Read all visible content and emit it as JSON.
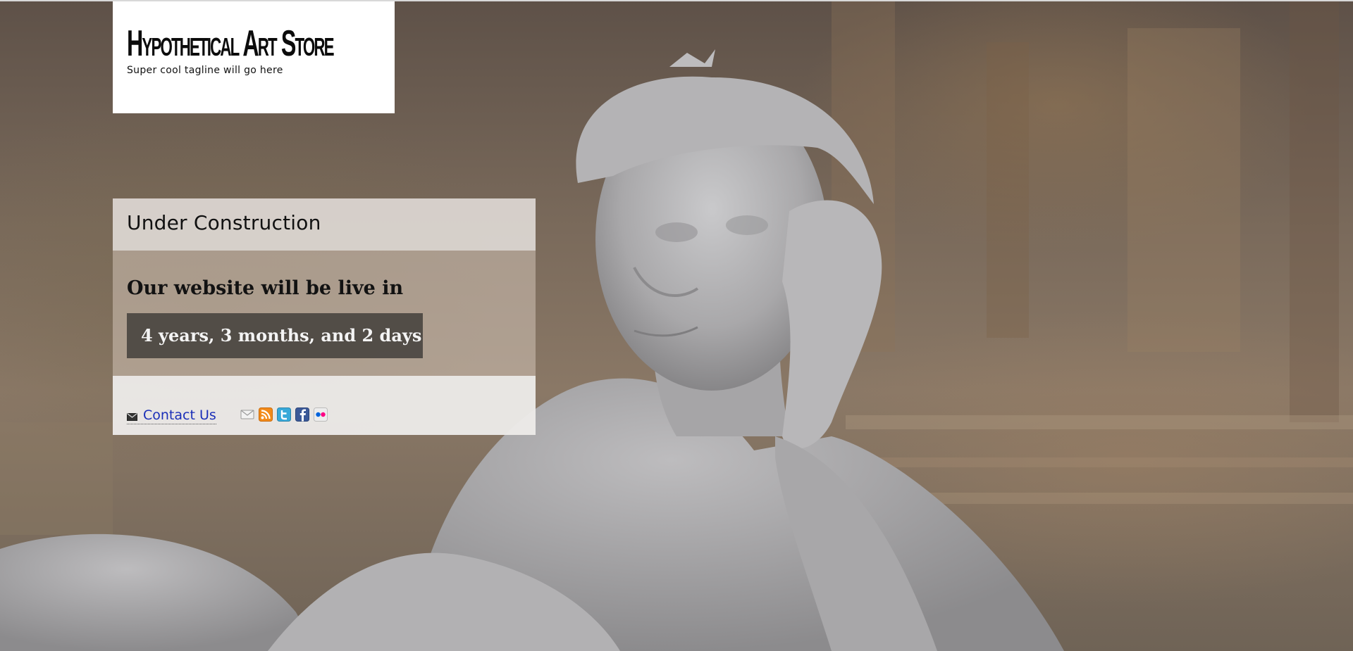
{
  "header": {
    "site_title": "Hypothetical Art Store",
    "tagline": "Super cool tagline will go here"
  },
  "panel": {
    "heading": "Under Construction",
    "live_text": "Our website will be live in",
    "countdown": "4 years, 3 months, and 2 days"
  },
  "footer": {
    "contact_label": "Contact Us",
    "social_icons": [
      "email-icon",
      "rss-icon",
      "twitter-icon",
      "facebook-icon",
      "flickr-icon"
    ]
  },
  "colors": {
    "link": "#1a2fb8",
    "countdown_bg": "#46423e",
    "rss": "#f28a1a",
    "twitter": "#38a9d9",
    "facebook": "#3b5998",
    "flickr_pink": "#ff0084",
    "flickr_blue": "#0063dc"
  }
}
